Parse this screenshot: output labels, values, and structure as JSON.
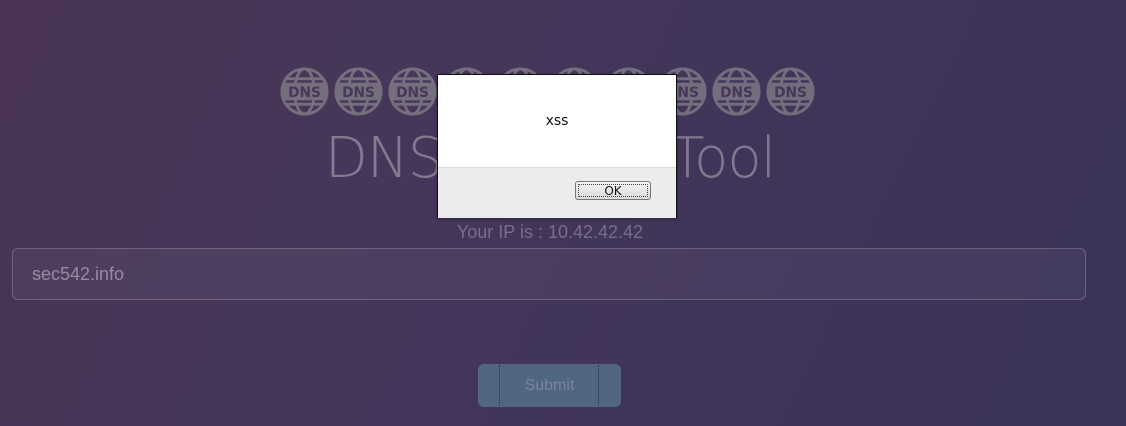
{
  "page": {
    "logo_icon": "dns-globe-icon",
    "logo_text": "DNS",
    "logo_count": 10,
    "title": "DNS Lookup Tool",
    "ip_line": "Your IP is : 10.42.42.42"
  },
  "form": {
    "domain_value": "sec542.info",
    "submit_label": "Submit"
  },
  "alert": {
    "message": "xss",
    "ok_label": "OK"
  },
  "colors": {
    "background": "#45365a",
    "submit_button": "#5f8ea6",
    "logo_gray": "#9c9c9c"
  }
}
